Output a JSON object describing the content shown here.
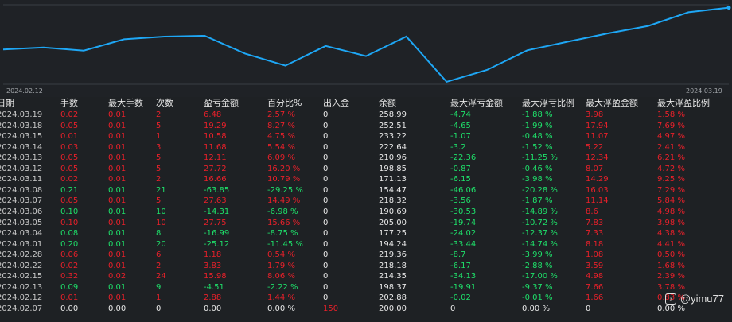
{
  "chart_data": {
    "type": "line",
    "x_start_label": "2024.02.12",
    "x_end_label": "2024.03.19",
    "x": [
      "2024.02.07",
      "2024.02.12",
      "2024.02.13",
      "2024.02.15",
      "2024.02.22",
      "2024.02.28",
      "2024.03.01",
      "2024.03.04",
      "2024.03.05",
      "2024.03.06",
      "2024.03.07",
      "2024.03.08",
      "2024.03.11",
      "2024.03.12",
      "2024.03.13",
      "2024.03.14",
      "2024.03.15",
      "2024.03.18",
      "2024.03.19"
    ],
    "values": [
      200.0,
      202.88,
      198.37,
      214.35,
      218.18,
      219.36,
      194.24,
      177.25,
      205.0,
      190.69,
      218.32,
      154.47,
      171.13,
      198.85,
      210.96,
      222.64,
      233.22,
      252.51,
      258.99
    ],
    "color": "#1ea7f5",
    "grid": false
  },
  "headers": {
    "date": "日期",
    "lots": "手数",
    "max_lots": "最大手数",
    "count": "次数",
    "pnl": "盈亏金额",
    "pct": "百分比%",
    "inout": "出入金",
    "balance": "余额",
    "max_float_loss": "最大浮亏金额",
    "max_float_loss_pct": "最大浮亏比例",
    "max_float_profit": "最大浮盈金额",
    "max_float_profit_pct": "最大浮盈比例"
  },
  "rows": [
    {
      "date": "2024.03.19",
      "lots": "0.02",
      "max_lots": "0.01",
      "count": "2",
      "pnl": "6.48",
      "pct": "2.57 %",
      "inout": "0",
      "balance": "258.99",
      "mfl": "-4.74",
      "mflp": "-1.88 %",
      "mfp": "3.98",
      "mfpp": "1.58 %",
      "sign": "pos"
    },
    {
      "date": "2024.03.18",
      "lots": "0.05",
      "max_lots": "0.01",
      "count": "5",
      "pnl": "19.29",
      "pct": "8.27 %",
      "inout": "0",
      "balance": "252.51",
      "mfl": "-4.65",
      "mflp": "-1.99 %",
      "mfp": "17.94",
      "mfpp": "7.69 %",
      "sign": "pos"
    },
    {
      "date": "2024.03.15",
      "lots": "0.01",
      "max_lots": "0.01",
      "count": "1",
      "pnl": "10.58",
      "pct": "4.75 %",
      "inout": "0",
      "balance": "233.22",
      "mfl": "-1.07",
      "mflp": "-0.48 %",
      "mfp": "11.07",
      "mfpp": "4.97 %",
      "sign": "pos"
    },
    {
      "date": "2024.03.14",
      "lots": "0.03",
      "max_lots": "0.01",
      "count": "3",
      "pnl": "11.68",
      "pct": "5.54 %",
      "inout": "0",
      "balance": "222.64",
      "mfl": "-3.2",
      "mflp": "-1.52 %",
      "mfp": "5.22",
      "mfpp": "2.41 %",
      "sign": "pos"
    },
    {
      "date": "2024.03.13",
      "lots": "0.05",
      "max_lots": "0.01",
      "count": "5",
      "pnl": "12.11",
      "pct": "6.09 %",
      "inout": "0",
      "balance": "210.96",
      "mfl": "-22.36",
      "mflp": "-11.25 %",
      "mfp": "12.34",
      "mfpp": "6.21 %",
      "sign": "pos"
    },
    {
      "date": "2024.03.12",
      "lots": "0.05",
      "max_lots": "0.01",
      "count": "5",
      "pnl": "27.72",
      "pct": "16.20 %",
      "inout": "0",
      "balance": "198.85",
      "mfl": "-0.87",
      "mflp": "-0.46 %",
      "mfp": "8.07",
      "mfpp": "4.72 %",
      "sign": "pos"
    },
    {
      "date": "2024.03.11",
      "lots": "0.02",
      "max_lots": "0.01",
      "count": "2",
      "pnl": "16.66",
      "pct": "10.79 %",
      "inout": "0",
      "balance": "171.13",
      "mfl": "-6.15",
      "mflp": "-3.98 %",
      "mfp": "14.29",
      "mfpp": "9.25 %",
      "sign": "pos"
    },
    {
      "date": "2024.03.08",
      "lots": "0.21",
      "max_lots": "0.01",
      "count": "21",
      "pnl": "-63.85",
      "pct": "-29.25 %",
      "inout": "0",
      "balance": "154.47",
      "mfl": "-46.06",
      "mflp": "-20.28 %",
      "mfp": "16.03",
      "mfpp": "7.29 %",
      "sign": "neg"
    },
    {
      "date": "2024.03.07",
      "lots": "0.05",
      "max_lots": "0.01",
      "count": "5",
      "pnl": "27.63",
      "pct": "14.49 %",
      "inout": "0",
      "balance": "218.32",
      "mfl": "-3.56",
      "mflp": "-1.87 %",
      "mfp": "11.14",
      "mfpp": "5.84 %",
      "sign": "pos"
    },
    {
      "date": "2024.03.06",
      "lots": "0.10",
      "max_lots": "0.01",
      "count": "10",
      "pnl": "-14.31",
      "pct": "-6.98 %",
      "inout": "0",
      "balance": "190.69",
      "mfl": "-30.53",
      "mflp": "-14.89 %",
      "mfp": "8.6",
      "mfpp": "4.98 %",
      "sign": "neg"
    },
    {
      "date": "2024.03.05",
      "lots": "0.10",
      "max_lots": "0.01",
      "count": "10",
      "pnl": "27.75",
      "pct": "15.66 %",
      "inout": "0",
      "balance": "205.00",
      "mfl": "-19.74",
      "mflp": "-10.72 %",
      "mfp": "7.83",
      "mfpp": "3.98 %",
      "sign": "pos"
    },
    {
      "date": "2024.03.04",
      "lots": "0.08",
      "max_lots": "0.01",
      "count": "8",
      "pnl": "-16.99",
      "pct": "-8.75 %",
      "inout": "0",
      "balance": "177.25",
      "mfl": "-24.02",
      "mflp": "-12.37 %",
      "mfp": "7.33",
      "mfpp": "4.38 %",
      "sign": "neg"
    },
    {
      "date": "2024.03.01",
      "lots": "0.20",
      "max_lots": "0.01",
      "count": "20",
      "pnl": "-25.12",
      "pct": "-11.45 %",
      "inout": "0",
      "balance": "194.24",
      "mfl": "-33.44",
      "mflp": "-14.74 %",
      "mfp": "8.18",
      "mfpp": "4.41 %",
      "sign": "neg"
    },
    {
      "date": "2024.02.28",
      "lots": "0.06",
      "max_lots": "0.01",
      "count": "6",
      "pnl": "1.18",
      "pct": "0.54 %",
      "inout": "0",
      "balance": "219.36",
      "mfl": "-8.7",
      "mflp": "-3.99 %",
      "mfp": "1.08",
      "mfpp": "0.50 %",
      "sign": "pos"
    },
    {
      "date": "2024.02.22",
      "lots": "0.02",
      "max_lots": "0.01",
      "count": "2",
      "pnl": "3.83",
      "pct": "1.79 %",
      "inout": "0",
      "balance": "218.18",
      "mfl": "-6.17",
      "mflp": "-2.88 %",
      "mfp": "3.59",
      "mfpp": "1.68 %",
      "sign": "pos"
    },
    {
      "date": "2024.02.15",
      "lots": "0.32",
      "max_lots": "0.02",
      "count": "24",
      "pnl": "15.98",
      "pct": "8.06 %",
      "inout": "0",
      "balance": "214.35",
      "mfl": "-34.13",
      "mflp": "-17.00 %",
      "mfp": "4.98",
      "mfpp": "2.39 %",
      "sign": "pos"
    },
    {
      "date": "2024.02.13",
      "lots": "0.09",
      "max_lots": "0.01",
      "count": "9",
      "pnl": "-4.51",
      "pct": "-2.22 %",
      "inout": "0",
      "balance": "198.37",
      "mfl": "-19.91",
      "mflp": "-9.37 %",
      "mfp": "7.66",
      "mfpp": "3.78 %",
      "sign": "neg"
    },
    {
      "date": "2024.02.12",
      "lots": "0.01",
      "max_lots": "0.01",
      "count": "1",
      "pnl": "2.88",
      "pct": "1.44 %",
      "inout": "0",
      "balance": "202.88",
      "mfl": "-0.02",
      "mflp": "-0.01 %",
      "mfp": "1.66",
      "mfpp": "0.83 %",
      "sign": "pos"
    },
    {
      "date": "2024.02.07",
      "lots": "0.00",
      "max_lots": "0.00",
      "count": "0",
      "pnl": "0.00",
      "pct": "0.00 %",
      "inout": "150",
      "balance": "200.00",
      "mfl": "0",
      "mflp": "0.00 %",
      "mfp": "0",
      "mfpp": "0.00 %",
      "sign": "zero"
    }
  ],
  "watermark": {
    "logo": "♪",
    "text": "@yimu77"
  },
  "colors": {
    "background": "#1f2226",
    "line": "#1ea7f5",
    "positive": "#e8202a",
    "negative": "#1ee06a"
  }
}
